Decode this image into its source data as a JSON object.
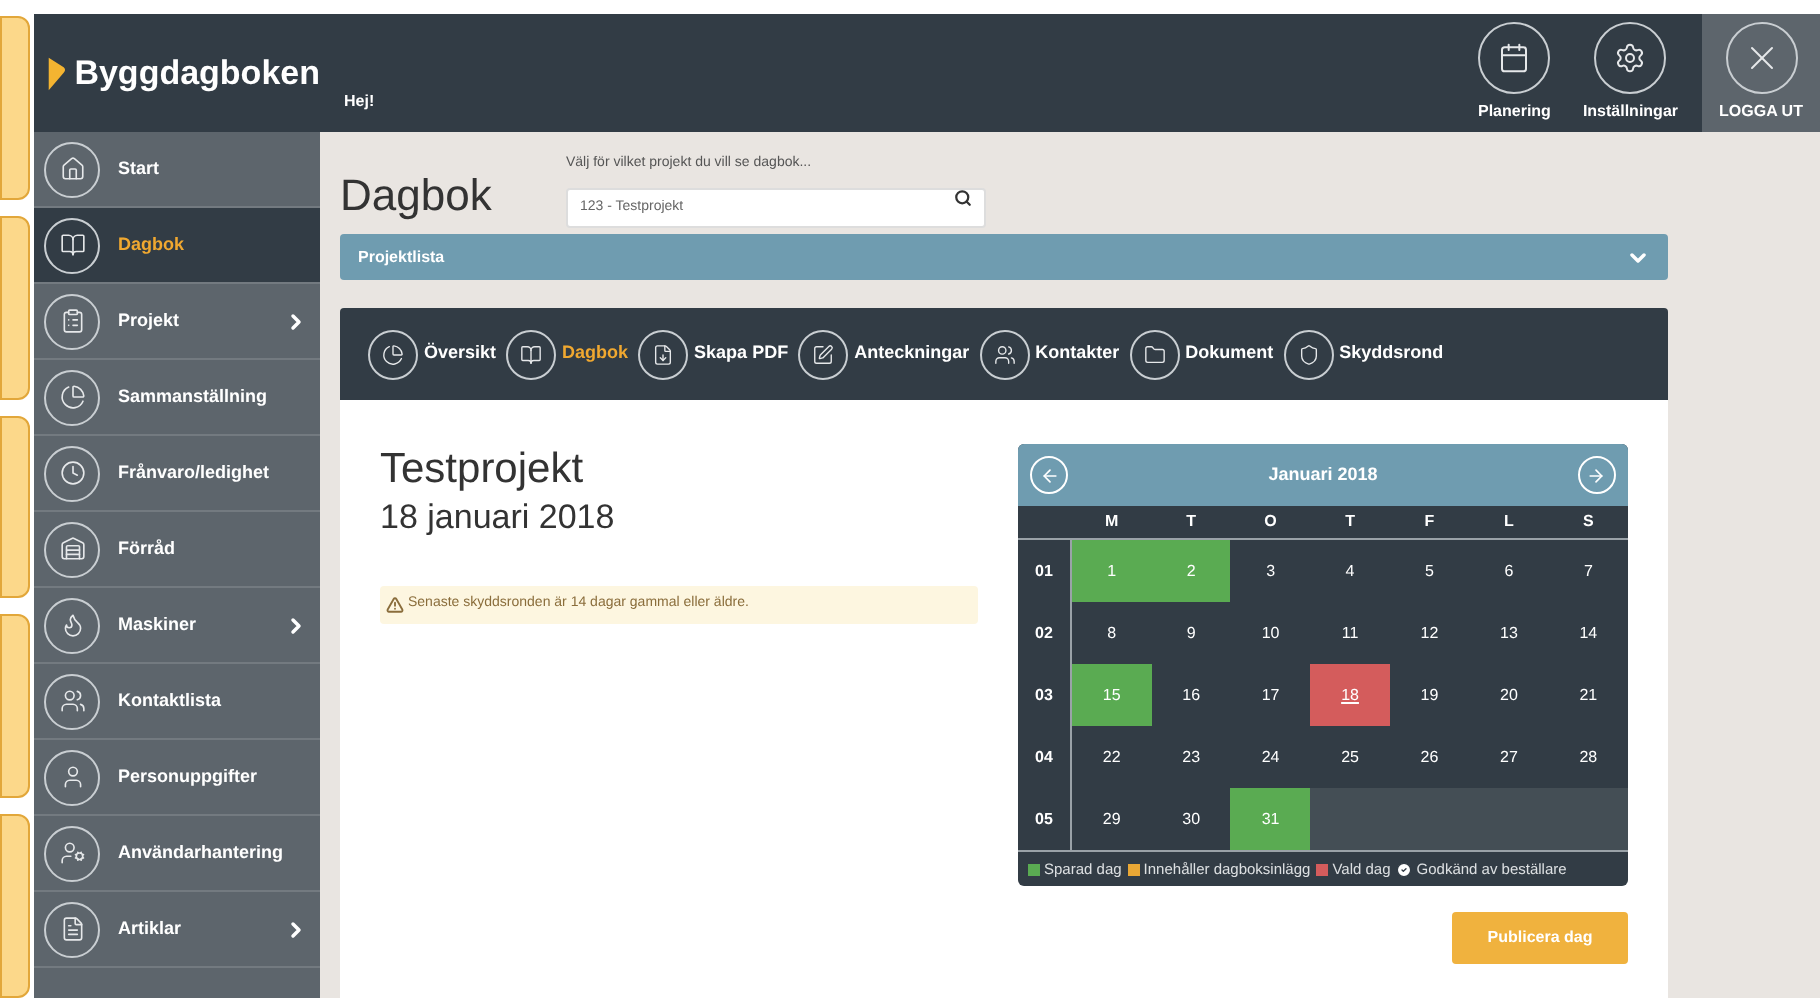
{
  "header": {
    "brand": "Byggdagboken",
    "greeting": "Hej!",
    "actions": [
      {
        "kind": "calendar",
        "label": "Planering"
      },
      {
        "kind": "settings",
        "label": "Inställningar"
      }
    ],
    "logout": {
      "label": "LOGGA UT"
    }
  },
  "sidebar": {
    "items": [
      {
        "kind": "home",
        "label": "Start",
        "selected": false,
        "submenu": false
      },
      {
        "kind": "book",
        "label": "Dagbok",
        "selected": true,
        "submenu": false
      },
      {
        "kind": "project",
        "label": "Projekt",
        "selected": false,
        "submenu": true
      },
      {
        "kind": "chart",
        "label": "Sammanställning",
        "selected": false,
        "submenu": false
      },
      {
        "kind": "absence",
        "label": "Frånvaro/ledighet",
        "selected": false,
        "submenu": false
      },
      {
        "kind": "warehouse",
        "label": "Förråd",
        "selected": false,
        "submenu": false
      },
      {
        "kind": "flame",
        "label": "Maskiner",
        "selected": false,
        "submenu": true
      },
      {
        "kind": "contacts",
        "label": "Kontaktlista",
        "selected": false,
        "submenu": false
      },
      {
        "kind": "person",
        "label": "Personuppgifter",
        "selected": false,
        "submenu": false
      },
      {
        "kind": "usergear",
        "label": "Användarhantering",
        "selected": false,
        "submenu": false
      },
      {
        "kind": "file",
        "label": "Artiklar",
        "selected": false,
        "submenu": true
      }
    ]
  },
  "page": {
    "title": "Dagbok",
    "search": {
      "label": "Välj för vilket projekt du vill se dagbok...",
      "value": "123 - Testprojekt"
    },
    "project_list": {
      "label": "Projektlista",
      "expanded": false
    }
  },
  "tabs": [
    {
      "kind": "chart",
      "label": "Översikt",
      "selected": false
    },
    {
      "kind": "book",
      "label": "Dagbok",
      "selected": true
    },
    {
      "kind": "pdf",
      "label": "Skapa PDF",
      "selected": false
    },
    {
      "kind": "note",
      "label": "Anteckningar",
      "selected": false
    },
    {
      "kind": "contacts",
      "label": "Kontakter",
      "selected": false
    },
    {
      "kind": "folder",
      "label": "Dokument",
      "selected": false
    },
    {
      "kind": "shield",
      "label": "Skyddsrond",
      "selected": false
    }
  ],
  "project": {
    "name": "Testprojekt",
    "date": "18 januari 2018",
    "warning": "Senaste skyddsronden är 14 dagar gammal eller äldre."
  },
  "calendar": {
    "month": "Januari 2018",
    "weekdays": [
      "M",
      "T",
      "O",
      "T",
      "F",
      "L",
      "S"
    ],
    "weeks": [
      {
        "number": "01",
        "days": [
          {
            "day": "1",
            "saved": true,
            "selected": false
          },
          {
            "day": "2",
            "saved": true,
            "selected": false
          },
          {
            "day": "3",
            "saved": false,
            "selected": false
          },
          {
            "day": "4",
            "saved": false,
            "selected": false
          },
          {
            "day": "5",
            "saved": false,
            "selected": false
          },
          {
            "day": "6",
            "saved": false,
            "selected": false
          },
          {
            "day": "7",
            "saved": false,
            "selected": false
          }
        ]
      },
      {
        "number": "02",
        "days": [
          {
            "day": "8",
            "saved": false,
            "selected": false
          },
          {
            "day": "9",
            "saved": false,
            "selected": false
          },
          {
            "day": "10",
            "saved": false,
            "selected": false
          },
          {
            "day": "11",
            "saved": false,
            "selected": false
          },
          {
            "day": "12",
            "saved": false,
            "selected": false
          },
          {
            "day": "13",
            "saved": false,
            "selected": false
          },
          {
            "day": "14",
            "saved": false,
            "selected": false
          }
        ]
      },
      {
        "number": "03",
        "days": [
          {
            "day": "15",
            "saved": true,
            "selected": false
          },
          {
            "day": "16",
            "saved": false,
            "selected": false
          },
          {
            "day": "17",
            "saved": false,
            "selected": false
          },
          {
            "day": "18",
            "saved": false,
            "selected": true
          },
          {
            "day": "19",
            "saved": false,
            "selected": false
          },
          {
            "day": "20",
            "saved": false,
            "selected": false
          },
          {
            "day": "21",
            "saved": false,
            "selected": false
          }
        ]
      },
      {
        "number": "04",
        "days": [
          {
            "day": "22",
            "saved": false,
            "selected": false
          },
          {
            "day": "23",
            "saved": false,
            "selected": false
          },
          {
            "day": "24",
            "saved": false,
            "selected": false
          },
          {
            "day": "25",
            "saved": false,
            "selected": false
          },
          {
            "day": "26",
            "saved": false,
            "selected": false
          },
          {
            "day": "27",
            "saved": false,
            "selected": false
          },
          {
            "day": "28",
            "saved": false,
            "selected": false
          }
        ]
      },
      {
        "number": "05",
        "days": [
          {
            "day": "29",
            "saved": false,
            "selected": false
          },
          {
            "day": "30",
            "saved": false,
            "selected": false
          },
          {
            "day": "31",
            "saved": true,
            "selected": false
          }
        ]
      }
    ],
    "legend": [
      {
        "kind": "swatch",
        "label": "Sparad dag",
        "color": "#5aab52"
      },
      {
        "kind": "swatch",
        "label": "Innehåller dagboksinlägg",
        "color": "#e8a735"
      },
      {
        "kind": "swatch",
        "label": "Vald dag",
        "color": "#d45c5c"
      },
      {
        "kind": "check",
        "label": "Godkänd av beställare"
      }
    ]
  },
  "publish_button": "Publicera dag"
}
